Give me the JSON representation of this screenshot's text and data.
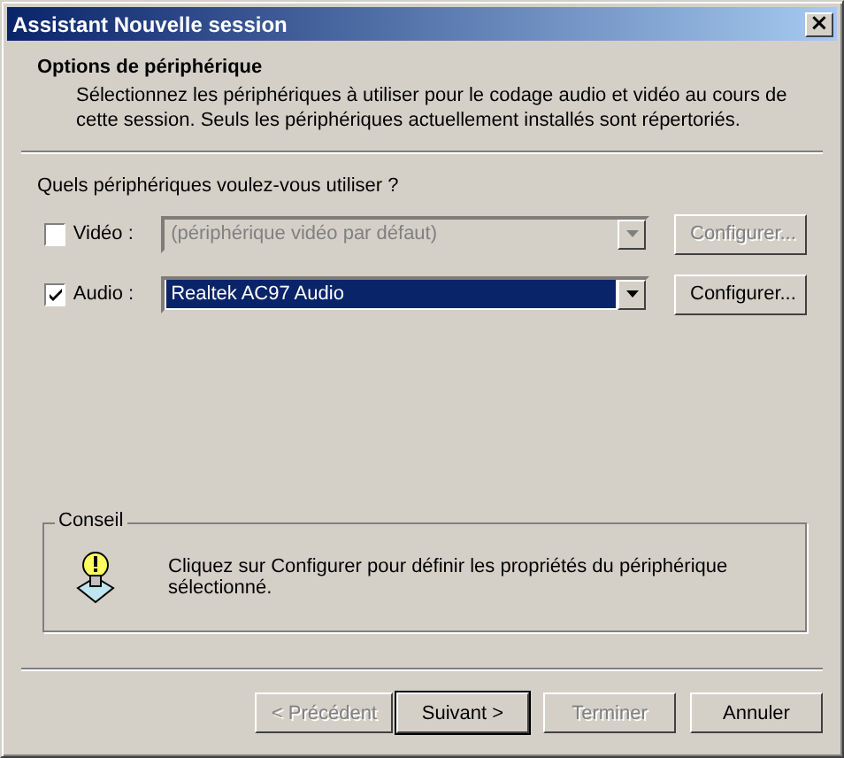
{
  "window": {
    "title": "Assistant Nouvelle session",
    "close": "×"
  },
  "header": {
    "title": "Options de périphérique",
    "description": "Sélectionnez les périphériques à utiliser pour le codage audio et vidéo au cours de cette session. Seuls les périphériques actuellement installés sont répertoriés."
  },
  "question": "Quels périphériques voulez-vous utiliser ?",
  "devices": [
    {
      "label": "Vidéo :",
      "checked": false,
      "value": "(périphérique vidéo par défaut)",
      "disabled": true,
      "button": "Configurer..."
    },
    {
      "label": "Audio :",
      "checked": true,
      "value": "Realtek AC97 Audio",
      "disabled": false,
      "button": "Configurer..."
    }
  ],
  "tip": {
    "title": "Conseil",
    "text": "Cliquez sur Configurer pour définir les propriétés du périphérique sélectionné."
  },
  "buttons": [
    {
      "label": "< Précédent",
      "disabled": true,
      "default": false
    },
    {
      "label": "Suivant >",
      "disabled": false,
      "default": true
    },
    {
      "label": "Terminer",
      "disabled": true,
      "default": false
    },
    {
      "label": "Annuler",
      "disabled": false,
      "default": false
    }
  ]
}
